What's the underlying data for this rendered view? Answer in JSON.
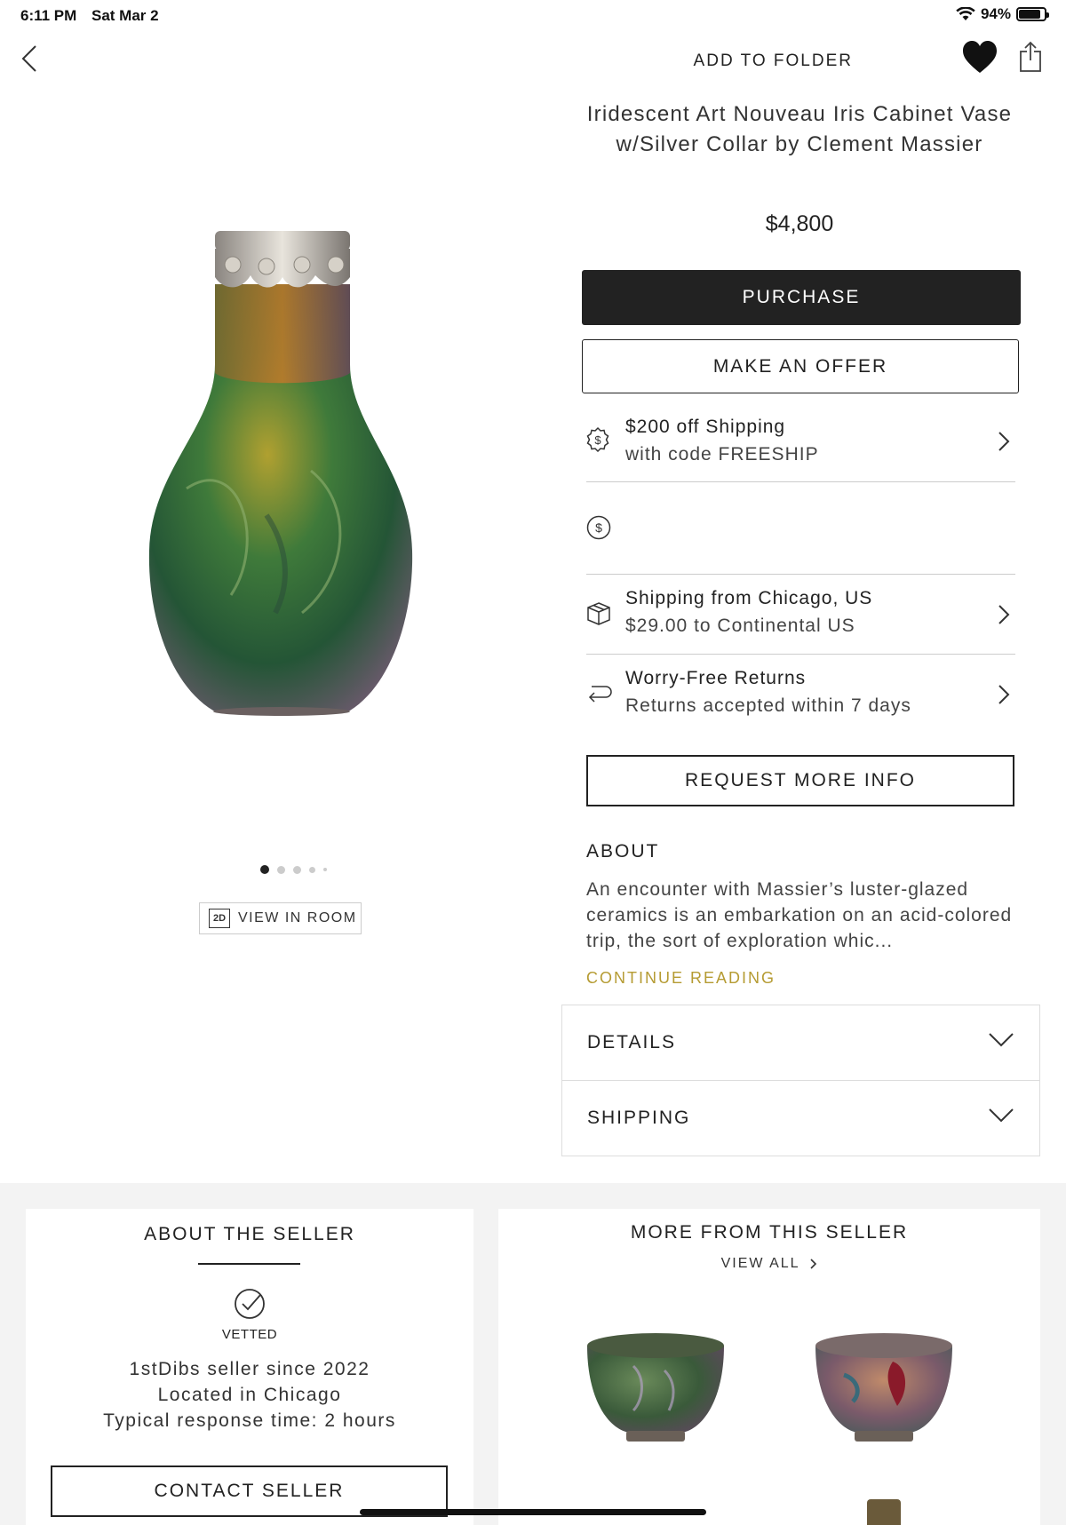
{
  "status_bar": {
    "time": "6:11 PM",
    "date": "Sat Mar 2",
    "battery": "94%",
    "battery_level": 0.94
  },
  "header": {
    "add_to_folder": "ADD TO FOLDER"
  },
  "product": {
    "title": "Iridescent Art Nouveau Iris Cabinet Vase w/Silver Collar by Clement Massier",
    "price": "$4,800",
    "purchase_label": "PURCHASE",
    "offer_label": "MAKE AN OFFER"
  },
  "promo": {
    "line1": "$200 off Shipping",
    "line2": "with code FREESHIP"
  },
  "shipping_row": {
    "line1": "Shipping from Chicago, US",
    "line2": "$29.00 to Continental US"
  },
  "returns_row": {
    "line1": "Worry-Free Returns",
    "line2": "Returns accepted within 7 days"
  },
  "request_info_label": "REQUEST MORE INFO",
  "about": {
    "heading": "ABOUT",
    "text": "An encounter with Massier’s luster-glazed ceramics is an embarkation on an acid-colored trip, the sort of exploration whic...",
    "continue": "CONTINUE READING"
  },
  "accordions": {
    "details": "DETAILS",
    "shipping": "SHIPPING"
  },
  "gallery": {
    "view_in_room": "VIEW IN ROOM",
    "icon_2d": "2D",
    "image_count": 5,
    "current_index": 1
  },
  "seller": {
    "heading": "ABOUT THE SELLER",
    "badge": "VETTED",
    "since": "1stDibs seller since 2022",
    "location": "Located in Chicago",
    "response": "Typical response time: 2 hours",
    "contact_label": "CONTACT SELLER"
  },
  "more": {
    "heading": "MORE FROM THIS SELLER",
    "view_all": "VIEW ALL"
  },
  "colors": {
    "accent_gold": "#b59b32",
    "dark_button": "#222222"
  }
}
